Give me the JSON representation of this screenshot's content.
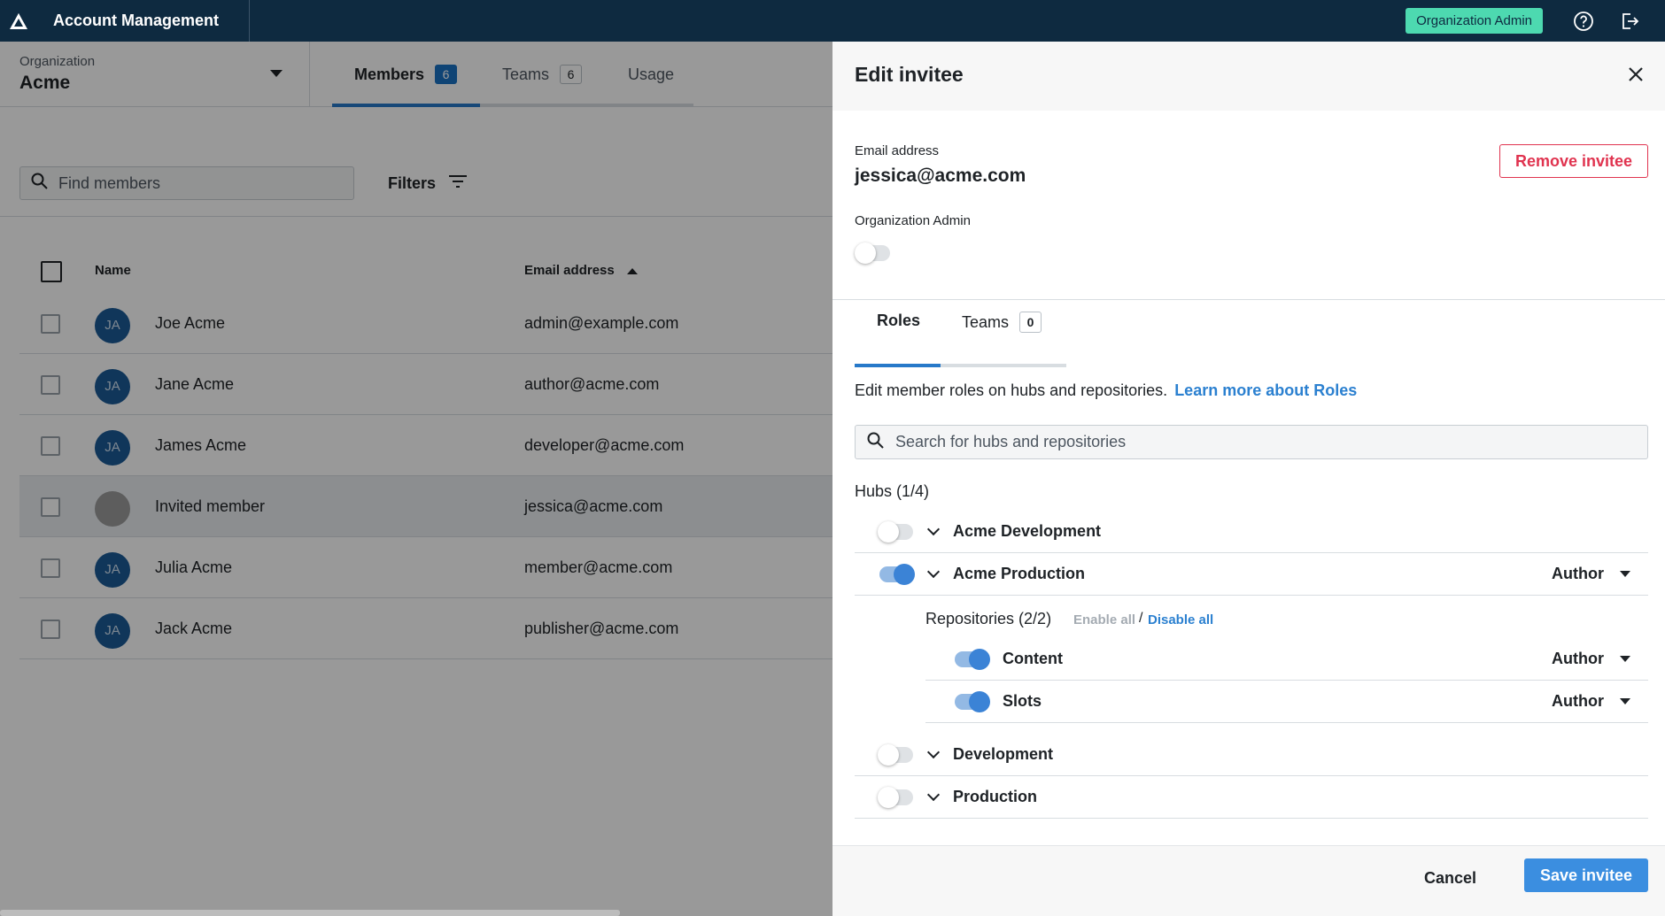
{
  "app": {
    "title": "Account Management",
    "role_badge": "Organization Admin"
  },
  "icons": {
    "logo": "triangle-logo-icon",
    "help": "help-circle-icon",
    "logout": "logout-icon"
  },
  "organization": {
    "label": "Organization",
    "name": "Acme"
  },
  "tabs": [
    {
      "label": "Members",
      "count": "6",
      "active": true
    },
    {
      "label": "Teams",
      "count": "6",
      "active": false
    },
    {
      "label": "Usage",
      "active": false
    }
  ],
  "search": {
    "placeholder": "Find members"
  },
  "filters": {
    "label": "Filters"
  },
  "table": {
    "headers": {
      "name": "Name",
      "email": "Email address"
    },
    "rows": [
      {
        "initials": "JA",
        "name": "Joe Acme",
        "email": "admin@example.com"
      },
      {
        "initials": "JA",
        "name": "Jane Acme",
        "email": "author@acme.com"
      },
      {
        "initials": "JA",
        "name": "James Acme",
        "email": "developer@acme.com"
      },
      {
        "initials": "",
        "name": "Invited member",
        "email": "jessica@acme.com"
      },
      {
        "initials": "JA",
        "name": "Julia Acme",
        "email": "member@acme.com"
      },
      {
        "initials": "JA",
        "name": "Jack Acme",
        "email": "publisher@acme.com"
      }
    ]
  },
  "panel": {
    "title": "Edit invitee",
    "email_label": "Email address",
    "email_value": "jessica@acme.com",
    "remove_label": "Remove invitee",
    "org_admin_label": "Organization Admin",
    "org_admin_enabled": false,
    "tabs": [
      {
        "label": "Roles",
        "active": true
      },
      {
        "label": "Teams",
        "count": "0",
        "active": false
      }
    ],
    "description": "Edit member roles on hubs and repositories.",
    "learn_more": "Learn more about Roles",
    "hub_search_placeholder": "Search for hubs and repositories",
    "hubs_label": "Hubs (1/4)",
    "hubs": [
      {
        "name": "Acme Development",
        "enabled": false
      },
      {
        "name": "Acme Production",
        "enabled": true,
        "role": "Author"
      },
      {
        "name": "Development",
        "enabled": false
      },
      {
        "name": "Production",
        "enabled": false
      }
    ],
    "repositories_label": "Repositories (2/2)",
    "enable_all": "Enable all",
    "separator": "/",
    "disable_all": "Disable all",
    "repositories": [
      {
        "name": "Content",
        "enabled": true,
        "role": "Author"
      },
      {
        "name": "Slots",
        "enabled": true,
        "role": "Author"
      }
    ],
    "cancel_label": "Cancel",
    "save_label": "Save invitee"
  },
  "colors": {
    "topbar": "#0e2a40",
    "accent": "#2779c9",
    "badge": "#4dd9b0",
    "danger": "#e0334f",
    "save": "#3b8ee0"
  }
}
